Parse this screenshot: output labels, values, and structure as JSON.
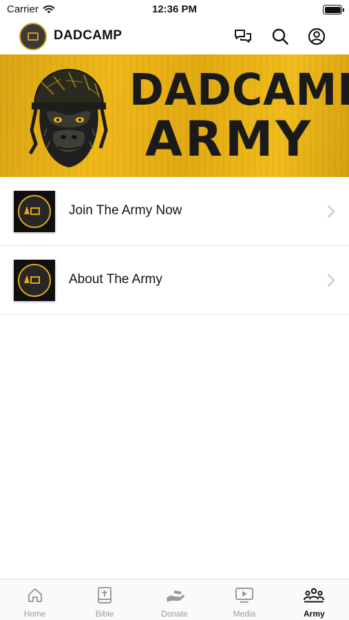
{
  "status_bar": {
    "carrier": "Carrier",
    "time": "12:36 PM",
    "battery_level": 1.0
  },
  "header": {
    "title": "DADCAMP",
    "icons": [
      "chat-icon",
      "search-icon",
      "profile-icon"
    ]
  },
  "banner": {
    "line1": "DADCAMP",
    "line2": "ARMY",
    "accent_color": "#eeb51b"
  },
  "list": {
    "items": [
      {
        "label": "Join The Army Now"
      },
      {
        "label": "About The Army"
      }
    ]
  },
  "tab_bar": {
    "tabs": [
      {
        "label": "Home",
        "icon": "home-icon",
        "active": false
      },
      {
        "label": "Bible",
        "icon": "bible-icon",
        "active": false
      },
      {
        "label": "Donate",
        "icon": "donate-icon",
        "active": false
      },
      {
        "label": "Media",
        "icon": "media-icon",
        "active": false
      },
      {
        "label": "Army",
        "icon": "army-icon",
        "active": true
      }
    ],
    "active_color": "#111111",
    "inactive_color": "#9a9a9a"
  }
}
